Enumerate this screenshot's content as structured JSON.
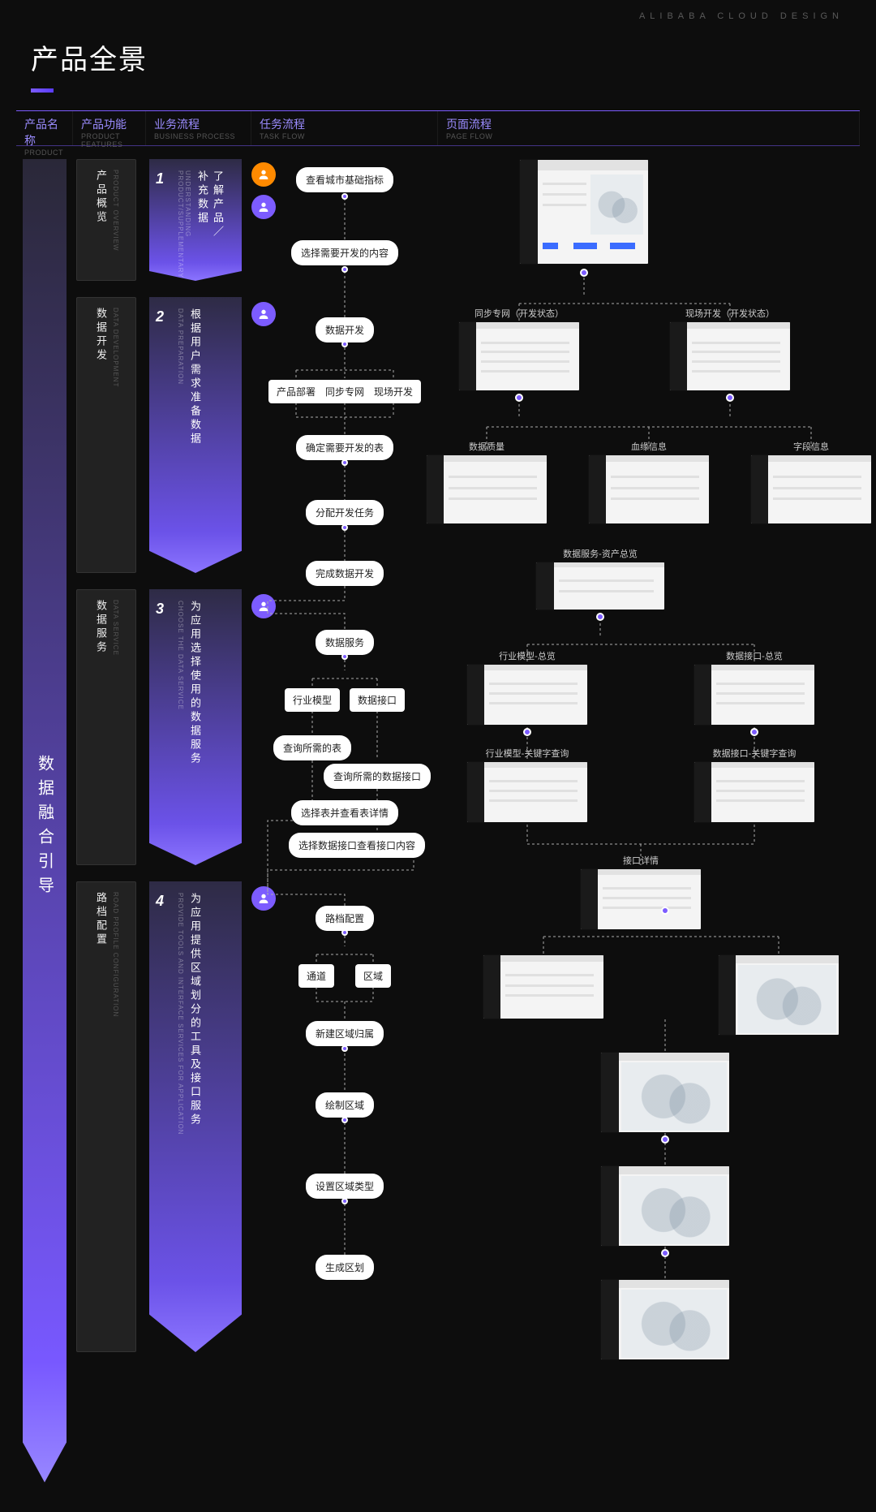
{
  "watermark": "ALIBABA CLOUD DESIGN",
  "page_title": "产品全景",
  "columns": [
    {
      "cn": "产品名称",
      "en": "PRODUCT"
    },
    {
      "cn": "产品功能",
      "en": "PRODUCT FEATURES"
    },
    {
      "cn": "业务流程",
      "en": "BUSINESS PROCESS"
    },
    {
      "cn": "任务流程",
      "en": "TASK FLOW"
    },
    {
      "cn": "页面流程",
      "en": "PAGE  FLOW"
    }
  ],
  "product_name": "数据融合引导",
  "features": [
    {
      "cn": "产品概览",
      "en": "PRODUCT OVERVIEW"
    },
    {
      "cn": "数据开发",
      "en": "DATA DEVELOPMENT"
    },
    {
      "cn": "数据服务",
      "en": "DATA  SERVICE"
    },
    {
      "cn": "路档配置",
      "en": "ROAD PROFILE CONFIGURATION"
    }
  ],
  "business": [
    {
      "num": "1",
      "cn": "了解产品／补充数据",
      "en": "UNDERSTANDING PRODUCT/SUPPLEMENTARY"
    },
    {
      "num": "2",
      "cn": "根据用户需求准备数据",
      "en": "DATA PREPARATION"
    },
    {
      "num": "3",
      "cn": "为应用选择使用的数据服务",
      "en": "CHOOSE THE DATA SERVICE"
    },
    {
      "num": "4",
      "cn": "为应用提供区域划分的工具及接口服务",
      "en": "PROVIDE TOOLS AND INTERFACE SERVICES FOR APPLICATION"
    }
  ],
  "task_nodes": {
    "n1": "查看城市基础指标",
    "n2": "选择需要开发的内容",
    "n3": "数据开发",
    "n3a": "产品部署",
    "n3b": "同步专网",
    "n3c": "现场开发",
    "n4": "确定需要开发的表",
    "n5": "分配开发任务",
    "n6": "完成数据开发",
    "n7": "数据服务",
    "n7a": "行业模型",
    "n7b": "数据接口",
    "n8": "查询所需的表",
    "n8b": "查询所需的数据接口",
    "n9": "选择表并查看表详情",
    "n9b": "选择数据接口查看接口内容",
    "n10": "路档配置",
    "n10a": "通道",
    "n10b": "区域",
    "n11": "新建区域归属",
    "n12": "绘制区域",
    "n13": "设置区域类型",
    "n14": "生成区划"
  },
  "page_flow_labels": {
    "p2a": "同步专网（开发状态）",
    "p2b": "现场开发（开发状态）",
    "p3a": "数据质量",
    "p3b": "血缘信息",
    "p3c": "字段信息",
    "p4": "数据服务-资产总览",
    "p5a": "行业模型-总览",
    "p5b": "数据接口-总览",
    "p6a": "行业模型-关键字查询",
    "p6b": "数据接口-关键字查询",
    "p7": "接口详情"
  }
}
